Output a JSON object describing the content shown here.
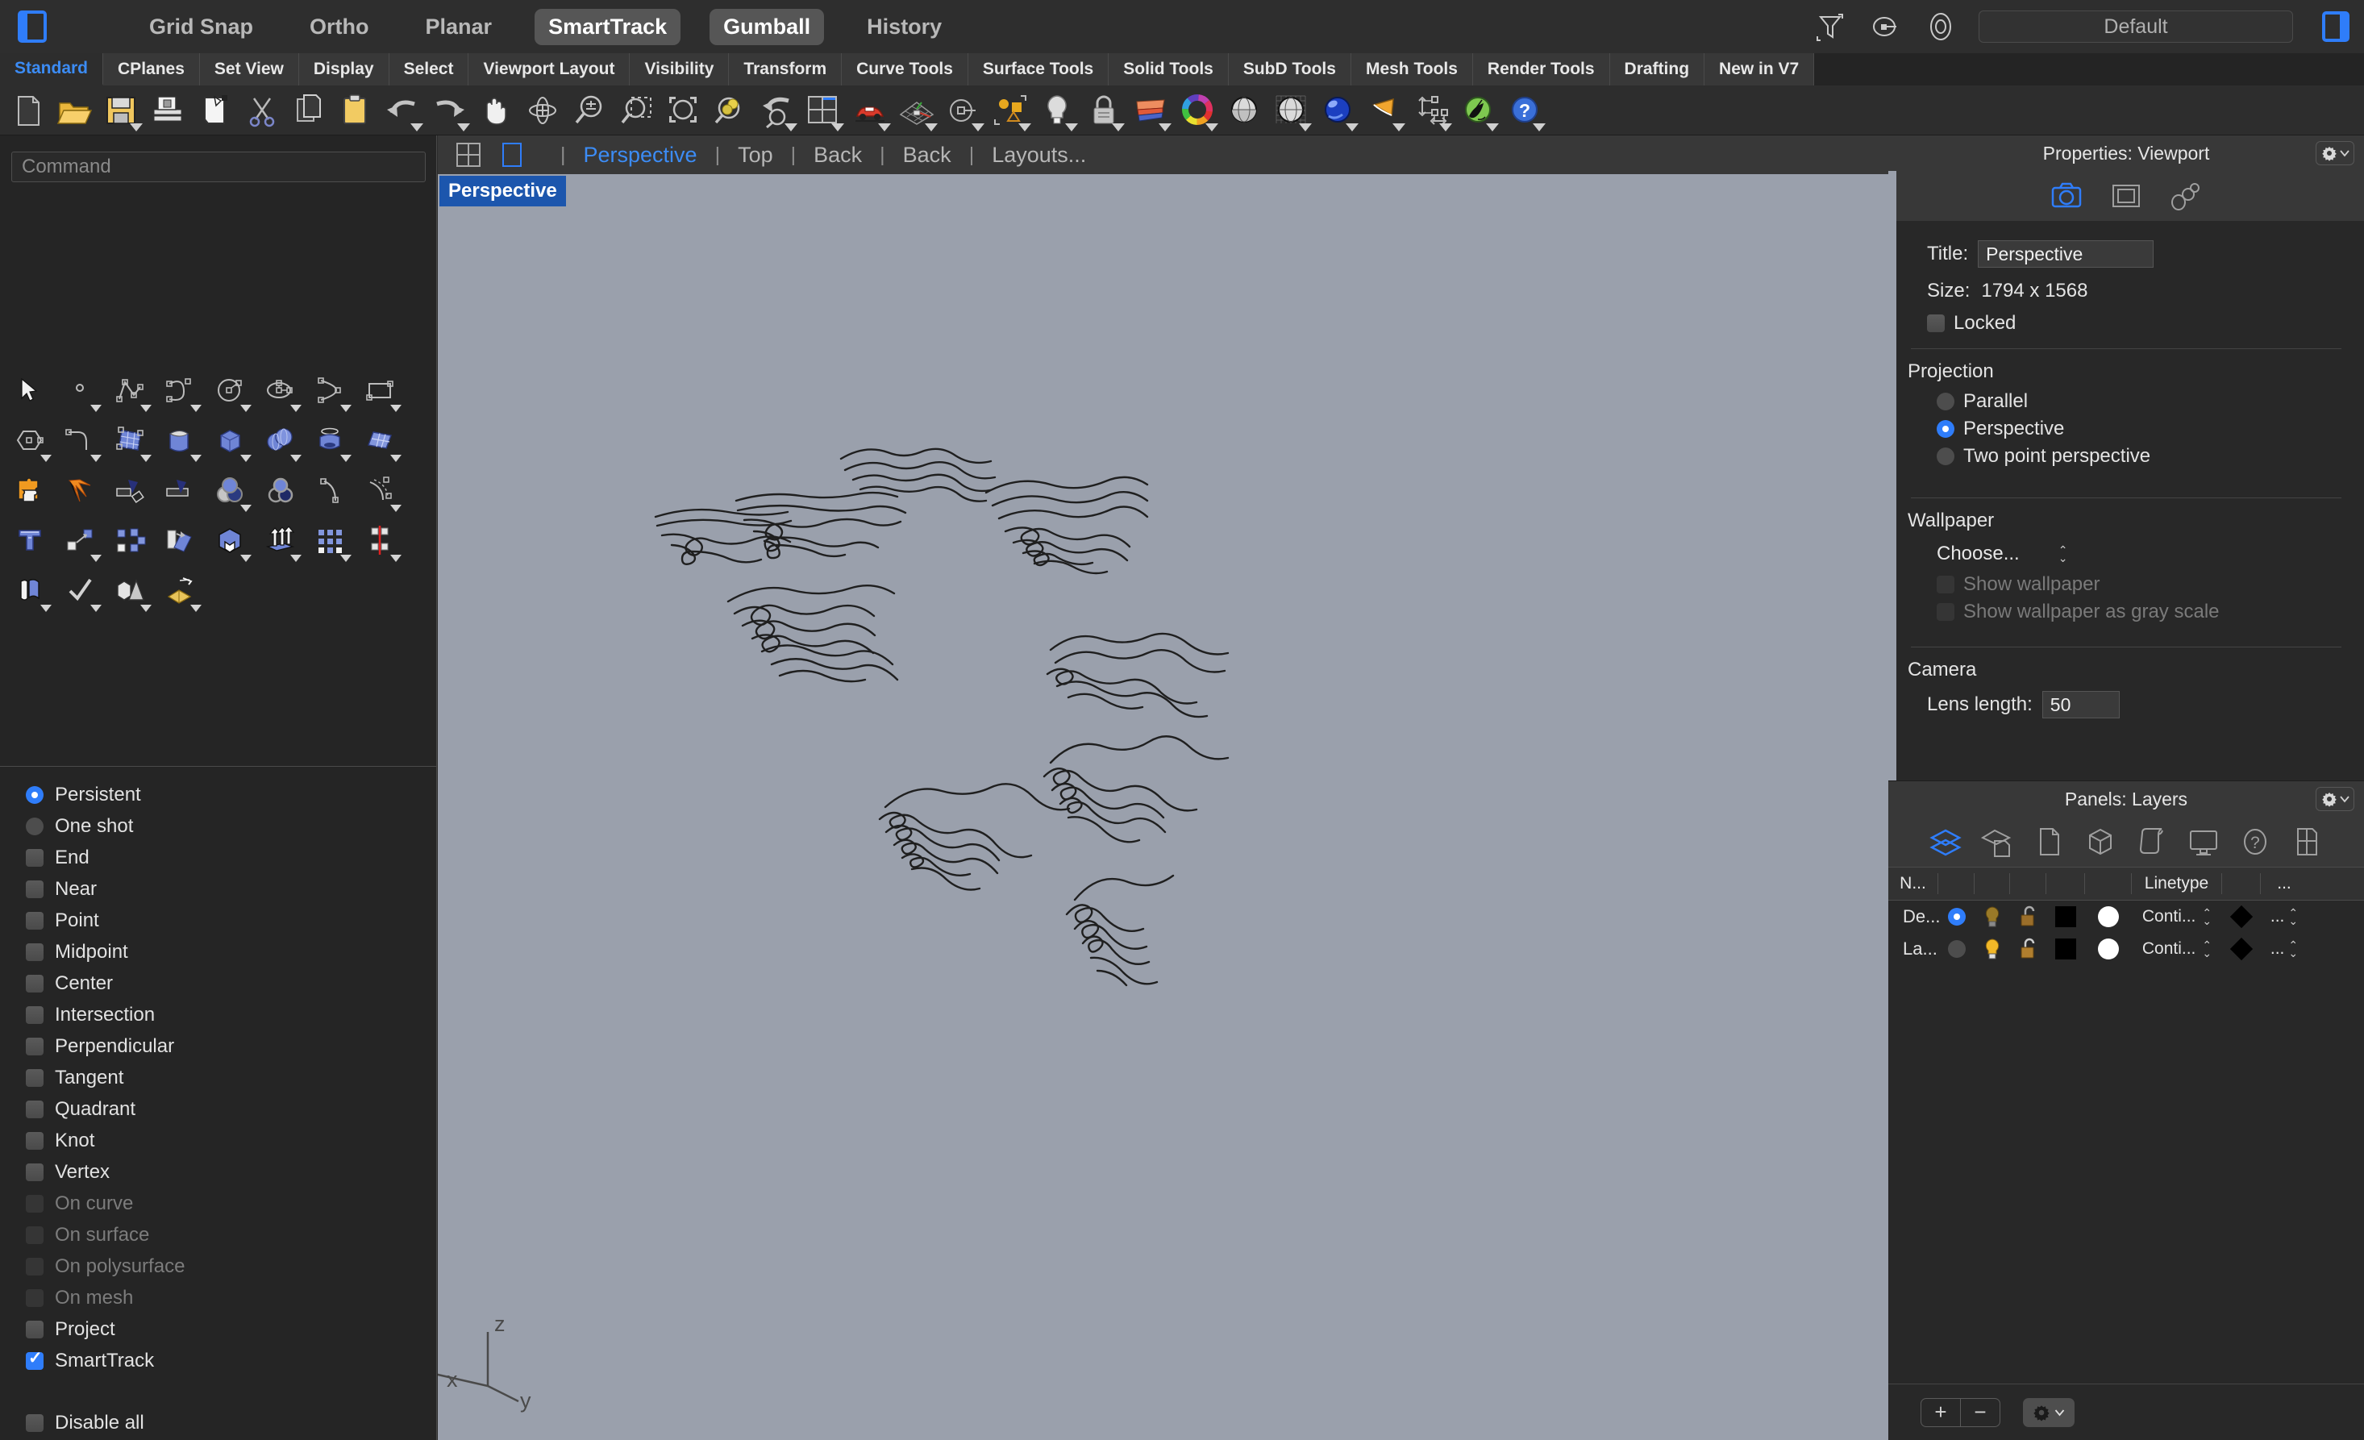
{
  "app": {
    "modes": [
      {
        "label": "Grid Snap",
        "active": false
      },
      {
        "label": "Ortho",
        "active": false
      },
      {
        "label": "Planar",
        "active": false
      },
      {
        "label": "SmartTrack",
        "active": true
      },
      {
        "label": "Gumball",
        "active": true
      },
      {
        "label": "History",
        "active": false
      }
    ],
    "default_field": "Default"
  },
  "ribbon": {
    "tabs": [
      {
        "label": "Standard",
        "active": true
      },
      {
        "label": "CPlanes",
        "active": false
      },
      {
        "label": "Set View",
        "active": false
      },
      {
        "label": "Display",
        "active": false
      },
      {
        "label": "Select",
        "active": false
      },
      {
        "label": "Viewport Layout",
        "active": false
      },
      {
        "label": "Visibility",
        "active": false
      },
      {
        "label": "Transform",
        "active": false
      },
      {
        "label": "Curve Tools",
        "active": false
      },
      {
        "label": "Surface Tools",
        "active": false
      },
      {
        "label": "Solid Tools",
        "active": false
      },
      {
        "label": "SubD Tools",
        "active": false
      },
      {
        "label": "Mesh Tools",
        "active": false
      },
      {
        "label": "Render Tools",
        "active": false
      },
      {
        "label": "Drafting",
        "active": false
      },
      {
        "label": "New in V7",
        "active": false
      }
    ]
  },
  "command": {
    "placeholder": "Command",
    "value": ""
  },
  "osnap": {
    "mode_options": [
      {
        "label": "Persistent",
        "selected": true
      },
      {
        "label": "One shot",
        "selected": false
      }
    ],
    "items": [
      {
        "label": "End",
        "checked": false,
        "enabled": true
      },
      {
        "label": "Near",
        "checked": false,
        "enabled": true
      },
      {
        "label": "Point",
        "checked": false,
        "enabled": true
      },
      {
        "label": "Midpoint",
        "checked": false,
        "enabled": true
      },
      {
        "label": "Center",
        "checked": false,
        "enabled": true
      },
      {
        "label": "Intersection",
        "checked": false,
        "enabled": true
      },
      {
        "label": "Perpendicular",
        "checked": false,
        "enabled": true
      },
      {
        "label": "Tangent",
        "checked": false,
        "enabled": true
      },
      {
        "label": "Quadrant",
        "checked": false,
        "enabled": true
      },
      {
        "label": "Knot",
        "checked": false,
        "enabled": true
      },
      {
        "label": "Vertex",
        "checked": false,
        "enabled": true
      },
      {
        "label": "On curve",
        "checked": false,
        "enabled": false
      },
      {
        "label": "On surface",
        "checked": false,
        "enabled": false
      },
      {
        "label": "On polysurface",
        "checked": false,
        "enabled": false
      },
      {
        "label": "On mesh",
        "checked": false,
        "enabled": false
      },
      {
        "label": "Project",
        "checked": false,
        "enabled": true
      },
      {
        "label": "SmartTrack",
        "checked": true,
        "enabled": true
      }
    ],
    "disable_all": {
      "label": "Disable all",
      "checked": false
    }
  },
  "viewport_header": {
    "tabs": [
      {
        "label": "Perspective",
        "active": true
      },
      {
        "label": "Top",
        "active": false
      },
      {
        "label": "Back",
        "active": false
      },
      {
        "label": "Back",
        "active": false
      },
      {
        "label": "Layouts...",
        "active": false
      }
    ]
  },
  "viewport": {
    "label": "Perspective",
    "axis": {
      "x": "x",
      "y": "y",
      "z": "z"
    },
    "background_color": "#9aa0ac",
    "curve_color": "#1c1c1c"
  },
  "properties": {
    "title": "Properties: Viewport",
    "tab_icons": [
      "camera-icon",
      "frame-icon",
      "chain-icon"
    ],
    "title_label": "Title:",
    "title_value": "Perspective",
    "size_label": "Size:",
    "size_value": "1794 x 1568",
    "locked": {
      "label": "Locked",
      "checked": false
    },
    "projection": {
      "heading": "Projection",
      "options": [
        {
          "label": "Parallel",
          "selected": false
        },
        {
          "label": "Perspective",
          "selected": true
        },
        {
          "label": "Two point perspective",
          "selected": false
        }
      ]
    },
    "wallpaper": {
      "heading": "Wallpaper",
      "choose_label": "Choose...",
      "show_wallpaper": {
        "label": "Show wallpaper",
        "checked": false,
        "enabled": false
      },
      "show_grayscale": {
        "label": "Show wallpaper as gray scale",
        "checked": false,
        "enabled": false
      }
    },
    "camera": {
      "heading": "Camera",
      "lens_label": "Lens length:",
      "lens_value": "50"
    }
  },
  "layers": {
    "title": "Panels: Layers",
    "tab_icons": [
      "layers-icon",
      "object-properties-icon",
      "document-icon",
      "cube-icon",
      "scroll-icon",
      "display-icon",
      "help-icon",
      "layout-icon"
    ],
    "columns": [
      "N...",
      "",
      "",
      "",
      "",
      "",
      "Linetype",
      "",
      "..."
    ],
    "rows": [
      {
        "name": "De...",
        "current": true,
        "on": true,
        "locked": false,
        "color": "#000000",
        "print_color": "#ffffff",
        "linetype": "Conti...",
        "print_width": "...",
        "material": "..."
      },
      {
        "name": "La...",
        "current": false,
        "on": true,
        "locked": false,
        "color": "#000000",
        "print_color": "#ffffff",
        "linetype": "Conti...",
        "print_width": "...",
        "material": "..."
      }
    ],
    "footer": {
      "add": "+",
      "remove": "−",
      "gear": "gear-icon"
    }
  },
  "colors": {
    "accent": "#2f7dfa",
    "panel_bg": "#282828",
    "toolbar_bg": "#2d2d2d",
    "viewport_bg": "#9aa0ac",
    "label_badge": "#1c56ad"
  }
}
